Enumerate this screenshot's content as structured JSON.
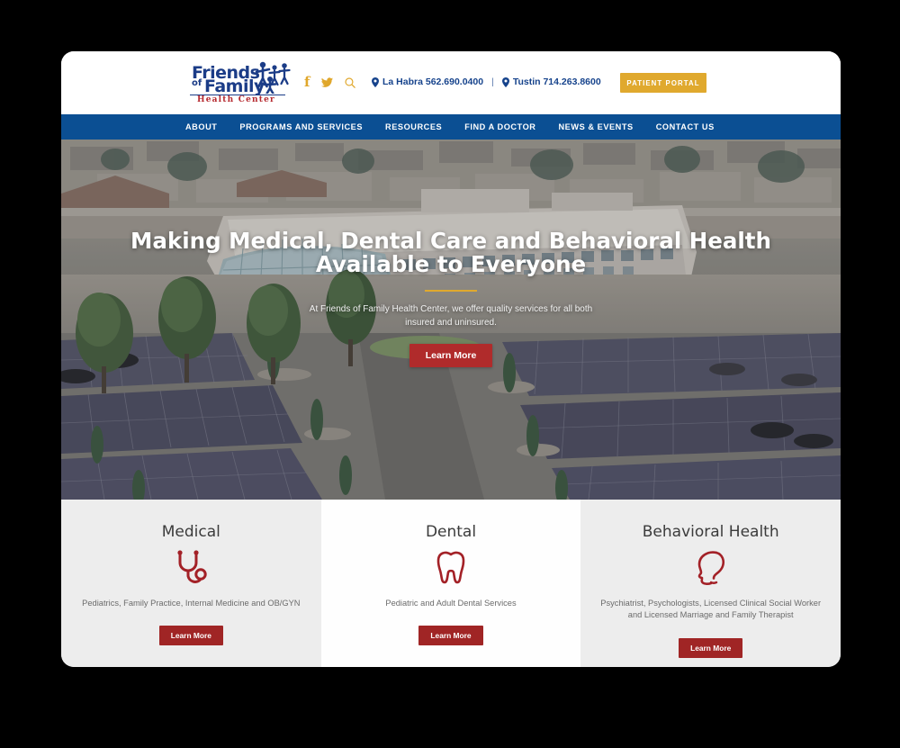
{
  "site": {
    "logo": {
      "line1": "Friends",
      "line2_small": "of",
      "line2": "Family",
      "line3": "Health Center",
      "icon": "family-figures-icon",
      "color_blue": "#1b3c87",
      "color_red": "#b5292f"
    },
    "social": [
      {
        "name": "facebook-icon",
        "glyph": "f"
      },
      {
        "name": "twitter-icon",
        "glyph": "bird"
      },
      {
        "name": "search-icon",
        "glyph": "magnifier"
      }
    ],
    "contacts": [
      {
        "label": "La Habra 562.690.0400",
        "icon": "location-pin-icon"
      },
      {
        "label": "Tustin 714.263.8600",
        "icon": "location-pin-icon"
      }
    ],
    "contact_separator": "|",
    "portal_button": "PATIENT PORTAL",
    "accent_gold": "#e0a92e",
    "nav_blue": "#0b4f93",
    "accent_red": "#b02b2b"
  },
  "nav": {
    "items": [
      {
        "label": "ABOUT"
      },
      {
        "label": "PROGRAMS AND SERVICES"
      },
      {
        "label": "RESOURCES"
      },
      {
        "label": "FIND A DOCTOR"
      },
      {
        "label": "NEWS & EVENTS"
      },
      {
        "label": "CONTACT US"
      }
    ]
  },
  "hero": {
    "title": "Making Medical, Dental Care and Behavioral Health Available to Everyone",
    "subtitle": "At Friends of Family Health Center, we offer quality services for all both insured and uninsured.",
    "button": "Learn More",
    "image_description": "aerial-view-of-health-center-campus-with-solar-carports"
  },
  "services": [
    {
      "title": "Medical",
      "icon": "stethoscope-icon",
      "description": "Pediatrics, Family Practice, Internal Medicine and OB/GYN",
      "button": "Learn More",
      "background": "#ededed"
    },
    {
      "title": "Dental",
      "icon": "tooth-icon",
      "description": "Pediatric and Adult Dental Services",
      "button": "Learn More",
      "background": "#fefefe"
    },
    {
      "title": "Behavioral Health",
      "icon": "head-profile-icon",
      "description": "Psychiatrist, Psychologists, Licensed Clinical Social Worker and Licensed Marriage and Family Therapist",
      "button": "Learn More",
      "background": "#ededed"
    }
  ]
}
